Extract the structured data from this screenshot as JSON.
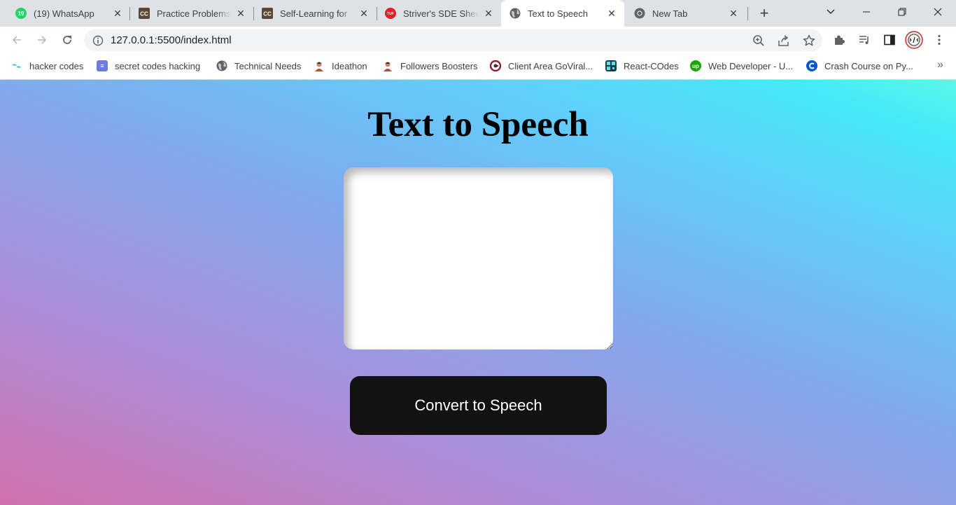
{
  "browser": {
    "tabs": [
      {
        "title": "(19) WhatsApp",
        "favicon": "whatsapp-icon",
        "badge": "19"
      },
      {
        "title": "Practice Problems",
        "favicon": "codechef-icon",
        "badge": "CC"
      },
      {
        "title": "Self-Learning for",
        "favicon": "codechef-icon",
        "badge": "CC"
      },
      {
        "title": "Striver's SDE Shee",
        "favicon": "takeuforward-icon",
        "badge": "TUF"
      },
      {
        "title": "Text to Speech",
        "favicon": "globe-icon",
        "active": true
      },
      {
        "title": "New Tab",
        "favicon": "chrome-icon"
      }
    ],
    "url": "127.0.0.1:5500/index.html",
    "bookmarks": [
      {
        "label": "hacker codes",
        "icon": "tailwind-icon",
        "color": "#38bdf8"
      },
      {
        "label": "secret codes hacking",
        "icon": "layers-icon",
        "color": "#6b7be0"
      },
      {
        "label": "Technical Needs",
        "icon": "globe-icon",
        "color": "#5f6368"
      },
      {
        "label": "Ideathon",
        "icon": "avatar-icon",
        "color": "#b0503a"
      },
      {
        "label": "Followers Boosters",
        "icon": "avatar-icon",
        "color": "#b0503a"
      },
      {
        "label": "Client Area GoViral...",
        "icon": "goviral-icon",
        "color": "#8b1e2e"
      },
      {
        "label": "React-COdes",
        "icon": "qr-icon",
        "color": "#1b3a4b"
      },
      {
        "label": "Web Developer - U...",
        "icon": "upwork-icon",
        "color": "#14a800"
      },
      {
        "label": "Crash Course on Py...",
        "icon": "coursera-icon",
        "color": "#0056d2"
      }
    ]
  },
  "page": {
    "heading": "Text to Speech",
    "textarea_value": "",
    "button_label": "Convert to Speech"
  },
  "colors": {
    "button_bg": "#121212",
    "gradient_start": "#d170ac",
    "gradient_mid": "#80a9ee",
    "gradient_end": "#5cf7e8"
  }
}
